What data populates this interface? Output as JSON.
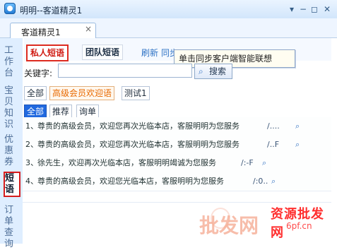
{
  "window": {
    "title": "明明--客道精灵1",
    "tab_label": "客道精灵1",
    "tab_close": "×"
  },
  "sidebar": {
    "items": [
      {
        "label": "工作台"
      },
      {
        "label": "宝贝知识"
      },
      {
        "label": "优惠券"
      },
      {
        "label": "短语"
      },
      {
        "label": "订单查询"
      }
    ]
  },
  "phrase_panel": {
    "private_tab": "私人短语",
    "team_tab": "团队短语",
    "refresh_label": "刷新",
    "sync_label": "同步",
    "tooltip": "单击同步客户端智能联想",
    "keyword_label": "关键字:",
    "keyword_value": "",
    "search_label": "搜索",
    "group_filters": [
      "全部",
      "高级会员欢迎语",
      "测试1"
    ],
    "type_filters": [
      "全部",
      "推荐",
      "询单"
    ]
  },
  "rows": [
    {
      "index": "1、",
      "text": "尊贵的高级会员，欢迎您再次光临本店，客服明明为您服务",
      "meta": "/...."
    },
    {
      "index": "2、",
      "text": "尊贵的高级会员，欢迎您再次光临本店，客服明明为您服务",
      "meta": "/..F"
    },
    {
      "index": "3、",
      "text": "徐先生，欢迎再次光临本店，客服明明竭诚为您服务",
      "meta": "/:-F"
    },
    {
      "index": "4、",
      "text": "尊贵的高级会员，欢迎您光临本店，客服明明为您服务",
      "meta": "/:0.."
    }
  ],
  "watermark": {
    "red_text": "资源批发网",
    "small_text": "6pf.cn",
    "big_text": "批发网"
  },
  "icons": {
    "app": "app-icon",
    "search": "search-icon",
    "close": "close-icon",
    "minimize": "minimize-icon",
    "restore": "restore-icon",
    "menu": "menu-icon"
  }
}
